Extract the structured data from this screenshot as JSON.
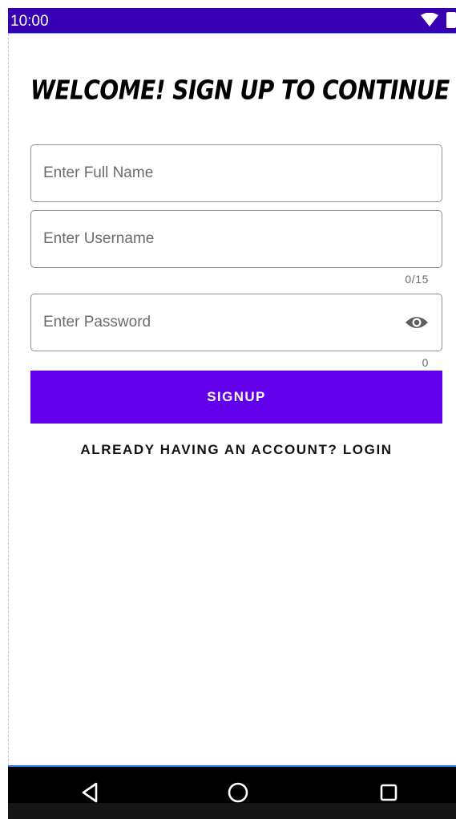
{
  "status_bar": {
    "time": "10:00",
    "background": "#3700b3",
    "icons": [
      "wifi-icon",
      "battery-icon"
    ]
  },
  "title": "WELCOME! SIGN UP TO CONTINUE",
  "form": {
    "fullname": {
      "placeholder": "Enter Full Name",
      "value": ""
    },
    "username": {
      "placeholder": "Enter Username",
      "value": "",
      "counter": "0/15"
    },
    "password": {
      "placeholder": "Enter Password",
      "value": "",
      "counter": "0",
      "toggle_icon": "eye-icon"
    }
  },
  "signup_button": {
    "label": "SIGNUP",
    "color": "#6200ee"
  },
  "login_link": "ALREADY HAVING AN ACCOUNT? LOGIN",
  "nav_bar": {
    "buttons": [
      "back-icon",
      "home-icon",
      "recents-icon"
    ]
  }
}
